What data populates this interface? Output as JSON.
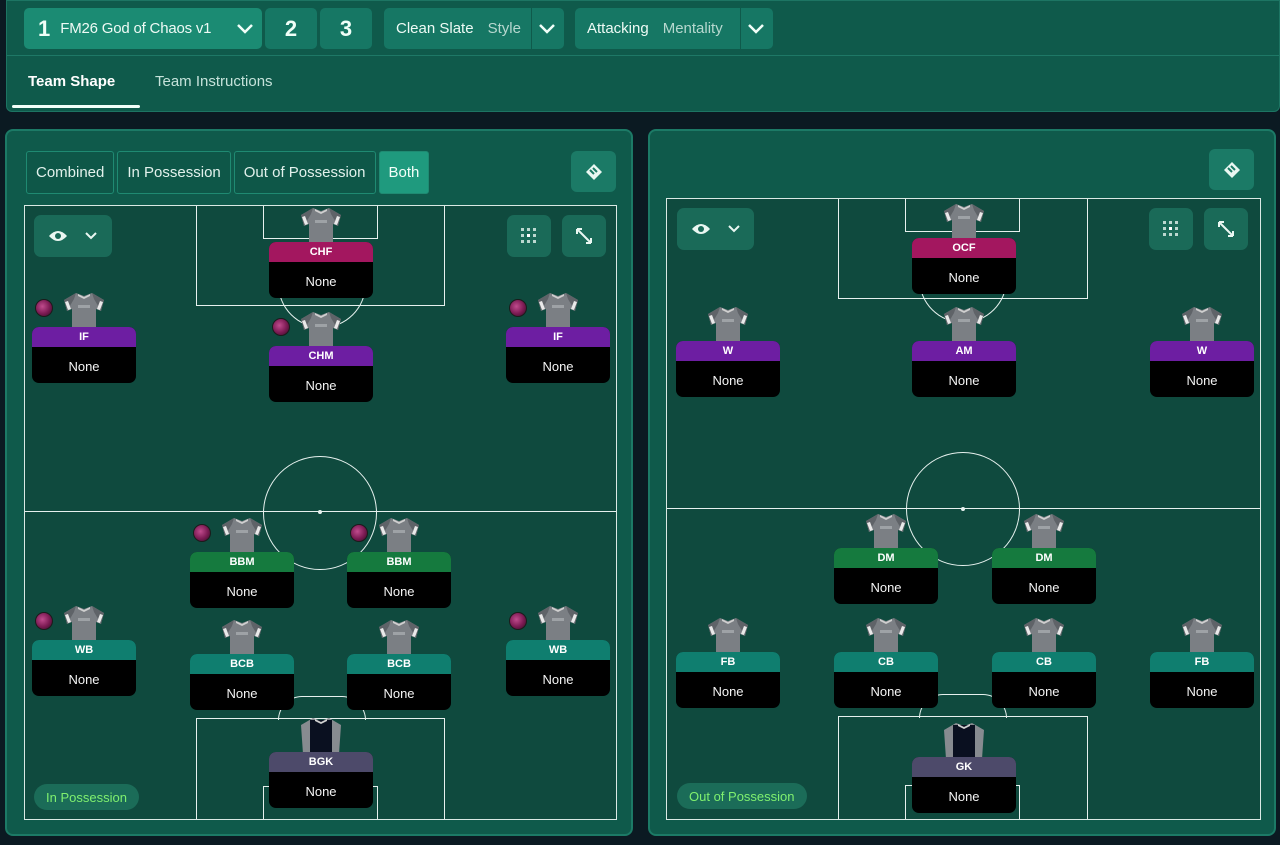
{
  "header": {
    "tactic_1_number": "1",
    "tactic_1_name": "FM26 God of Chaos v1",
    "tactic_2_number": "2",
    "tactic_3_number": "3",
    "style_value": "Clean Slate",
    "style_label": "Style",
    "mentality_value": "Attacking",
    "mentality_label": "Mentality",
    "tabs": [
      {
        "label": "Team Shape"
      },
      {
        "label": "Team Instructions"
      }
    ]
  },
  "left_panel": {
    "segments": [
      {
        "label": "Combined"
      },
      {
        "label": "In Possession"
      },
      {
        "label": "Out of Possession"
      },
      {
        "label": "Both"
      }
    ],
    "active_segment": "Both",
    "phase_pill": "In Possession",
    "players": [
      {
        "role": "CHF",
        "name": "None",
        "color": "#a3175f",
        "trait": false
      },
      {
        "role": "IF",
        "name": "None",
        "color": "#6d1ea2",
        "trait": true
      },
      {
        "role": "CHM",
        "name": "None",
        "color": "#6d1ea2",
        "trait": true
      },
      {
        "role": "IF",
        "name": "None",
        "color": "#6d1ea2",
        "trait": true
      },
      {
        "role": "BBM",
        "name": "None",
        "color": "#157a3e",
        "trait": true
      },
      {
        "role": "BBM",
        "name": "None",
        "color": "#157a3e",
        "trait": true
      },
      {
        "role": "WB",
        "name": "None",
        "color": "#0f7e6f",
        "trait": true
      },
      {
        "role": "BCB",
        "name": "None",
        "color": "#0f7e6f",
        "trait": false
      },
      {
        "role": "BCB",
        "name": "None",
        "color": "#0f7e6f",
        "trait": false
      },
      {
        "role": "WB",
        "name": "None",
        "color": "#0f7e6f",
        "trait": true
      },
      {
        "role": "BGK",
        "name": "None",
        "color": "#4d4a6a",
        "trait": false
      }
    ]
  },
  "right_panel": {
    "phase_pill": "Out of Possession",
    "players": [
      {
        "role": "OCF",
        "name": "None",
        "color": "#a3175f"
      },
      {
        "role": "W",
        "name": "None",
        "color": "#6d1ea2"
      },
      {
        "role": "AM",
        "name": "None",
        "color": "#6d1ea2"
      },
      {
        "role": "W",
        "name": "None",
        "color": "#6d1ea2"
      },
      {
        "role": "DM",
        "name": "None",
        "color": "#157a3e"
      },
      {
        "role": "DM",
        "name": "None",
        "color": "#157a3e"
      },
      {
        "role": "FB",
        "name": "None",
        "color": "#0f7e6f"
      },
      {
        "role": "CB",
        "name": "None",
        "color": "#0f7e6f"
      },
      {
        "role": "CB",
        "name": "None",
        "color": "#0f7e6f"
      },
      {
        "role": "FB",
        "name": "None",
        "color": "#0f7e6f"
      },
      {
        "role": "GK",
        "name": "None",
        "color": "#4d4a6a"
      }
    ]
  },
  "icons": [
    "chevron-down-icon",
    "tactic-board-icon",
    "eye-icon",
    "grid-icon",
    "expand-icon",
    "shirt-icon",
    "trait-icon"
  ]
}
